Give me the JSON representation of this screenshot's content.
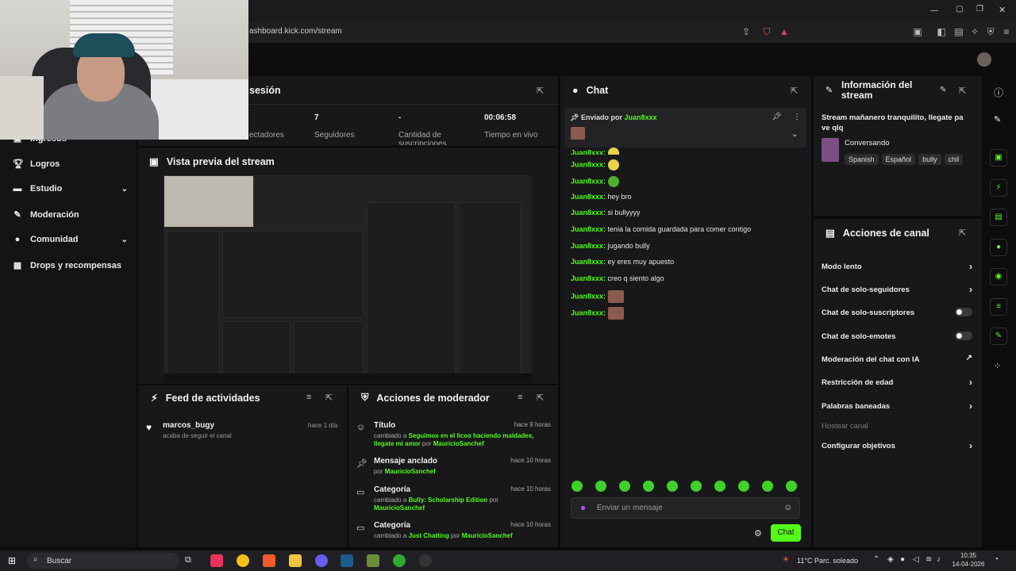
{
  "browser": {
    "url": "ashboard.kick.com/stream"
  },
  "sidebar": {
    "items": [
      {
        "label": "Ingresos",
        "icon": "wallet-icon"
      },
      {
        "label": "Logros",
        "icon": "trophy-icon"
      },
      {
        "label": "Estudio",
        "icon": "studio-icon"
      },
      {
        "label": "Moderación",
        "icon": "wrench-icon"
      },
      {
        "label": "Comunidad",
        "icon": "people-icon"
      },
      {
        "label": "Drops y recompensas",
        "icon": "gift-icon"
      }
    ]
  },
  "session": {
    "title": "sesión",
    "stats": [
      {
        "value": "",
        "label": "ectadores"
      },
      {
        "value": "7",
        "label": "Seguidores"
      },
      {
        "value": "-",
        "label": "Cantidad de suscripciones"
      },
      {
        "value": "00:06:58",
        "label": "Tiempo en vivo"
      }
    ]
  },
  "preview": {
    "title": "Vista previa del stream"
  },
  "feed": {
    "title": "Feed de actividades",
    "items": [
      {
        "user": "marcos_bugy",
        "text": "acaba de seguir el canal",
        "time": "hace 1 día"
      }
    ]
  },
  "mod_actions": {
    "title": "Acciones de moderador",
    "items": [
      {
        "title": "Título",
        "time": "hace 9 horas",
        "prefix": "cambiado a",
        "value": "Seguimos en el liceo haciendo maldades, llegate mi amor",
        "by_prefix": "por",
        "by": "MauricioSanchef"
      },
      {
        "title": "Mensaje anclado",
        "time": "hace 10 horas",
        "prefix": "",
        "value": "",
        "by_prefix": "por",
        "by": "MauricioSanchef"
      },
      {
        "title": "Categoría",
        "time": "hace 10 horas",
        "prefix": "cambiado a",
        "value": "Bully: Scholarship Edition",
        "by_prefix": "por",
        "by": "MauricioSanchef"
      },
      {
        "title": "Categoría",
        "time": "hace 10 horas",
        "prefix": "cambiado a",
        "value": "Just Chatting",
        "by_prefix": "por",
        "by": "MauricioSanchef"
      }
    ]
  },
  "chat": {
    "title": "Chat",
    "pinned_label": "Enviado por",
    "pinned_user": "Juan8xxx",
    "messages": [
      {
        "user": "Juan8xxx:",
        "text": "",
        "emote": "yellow"
      },
      {
        "user": "Juan8xxx:",
        "text": "",
        "emote": "green"
      },
      {
        "user": "Juan8xxx:",
        "text": "hey bro",
        "emote": ""
      },
      {
        "user": "Juan8xxx:",
        "text": "si bullyyyy",
        "emote": ""
      },
      {
        "user": "Juan8xxx:",
        "text": "tenia la comida guardada para comer contigo",
        "emote": ""
      },
      {
        "user": "Juan8xxx:",
        "text": "jugando bully",
        "emote": ""
      },
      {
        "user": "Juan8xxx:",
        "text": "ey eres muy apuesto",
        "emote": ""
      },
      {
        "user": "Juan8xxx:",
        "text": "creo q siento algo",
        "emote": ""
      },
      {
        "user": "Juan8xxx:",
        "text": "",
        "emote": "image"
      },
      {
        "user": "Juan8xxx:",
        "text": "",
        "emote": "image"
      }
    ],
    "input_placeholder": "Enviar un mensaje",
    "send_label": "Chat"
  },
  "stream_info": {
    "title": "Información del stream",
    "stream_title": "Stream mañanero tranquilito, llegate pa ve qlq",
    "category": "Conversando",
    "tags": [
      "Spanish",
      "Español",
      "bully",
      "chil"
    ]
  },
  "channel_actions": {
    "title": "Acciones de canal",
    "items": [
      {
        "label": "Modo lento",
        "control": "chevron"
      },
      {
        "label": "Chat de solo-seguidores",
        "control": "chevron"
      },
      {
        "label": "Chat de solo-suscriptores",
        "control": "toggle"
      },
      {
        "label": "Chat de solo-emotes",
        "control": "toggle"
      },
      {
        "label": "Moderación del chat con IA",
        "control": "external"
      },
      {
        "label": "Restricción de edad",
        "control": "chevron"
      },
      {
        "label": "Palabras baneadas",
        "control": "chevron"
      },
      {
        "label": "Hostear canal",
        "control": "none"
      },
      {
        "label": "Configurar objetivos",
        "control": "chevron"
      }
    ]
  },
  "taskbar": {
    "search": "Buscar",
    "weather": "11°C  Parc. soleado",
    "time": "10:35",
    "date": "14-04-2026"
  },
  "colors": {
    "accent": "#53fc18",
    "panel": "#18181b",
    "bg": "#0b0b0c"
  }
}
